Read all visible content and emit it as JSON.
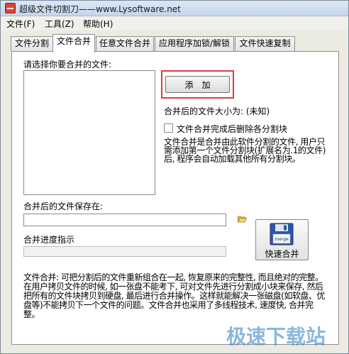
{
  "window": {
    "title": "超级文件切割刀——www.Lysoftware.net"
  },
  "menu": [
    {
      "label": "文件(F)"
    },
    {
      "label": "工具(Z)"
    },
    {
      "label": "帮助(H)"
    }
  ],
  "tabs": [
    {
      "label": "文件分割",
      "active": false
    },
    {
      "label": "文件合并",
      "active": true
    },
    {
      "label": "任意文件合并",
      "active": false
    },
    {
      "label": "应用程序加锁/解锁",
      "active": false
    },
    {
      "label": "文件快速复制",
      "active": false
    }
  ],
  "merge": {
    "select_label": "请选择你要合并的文件:",
    "add_button": "添加",
    "size_label": "合并后的文件大小为: (未知)",
    "delete_checkbox_label": "文件合并完成后删除各分割块",
    "delete_checked": false,
    "description": "文件合并是合并由此软件分割的文件, 用户只需添加第一个文件分割块(扩展名为.1的文件)后, 程序会自动加载其他所有分割块。",
    "save_label": "合并后的文件保存在:",
    "save_path": "",
    "progress_label": "合并进度指示",
    "progress": 0,
    "quick_merge_button": "快速合并",
    "quick_merge_icon_text": "merge",
    "help_text": "文件合并: 可把分割后的文件重新组合在一起, 恢复原来的完整性, 而且绝对的完整。在用户拷贝文件的时候, 如一张盘不能考下, 可对文件先进行分割成小块来保存, 然后把所有的文件块拷贝到硬盘, 最后进行合并操作。这样就能解决一张磁盘(如软盘、优盘等)不能拷贝下一个文件的问题。文件合并也采用了多线程技术, 速度快, 合并完整。"
  },
  "watermark": "极速下载站",
  "colors": {
    "highlight_box": "#e03b3b",
    "progress_fill": "#3fb34f",
    "watermark": "#3d86c4"
  }
}
